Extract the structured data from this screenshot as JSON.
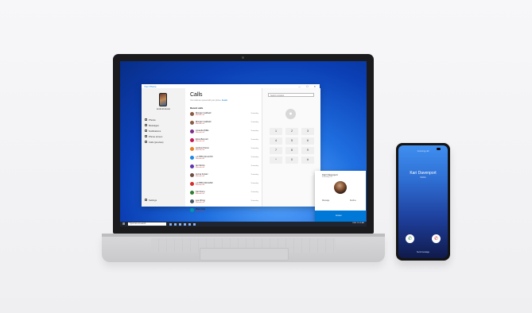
{
  "app": {
    "title": "Your Phone",
    "window_controls": "— ☐ ✕",
    "device_name": "Android device",
    "nav": [
      "Photos",
      "Messages",
      "Notifications",
      "Phone screen",
      "Calls (preview)"
    ],
    "settings": "Settings",
    "calls": {
      "heading": "Calls",
      "subtitle": "Your calls are synced with your phone.",
      "subtitle_link": "Details",
      "recent_label": "Recent calls",
      "rows": [
        {
          "name": "Morgan Caldwell",
          "type": "Missed call",
          "time": "Yesterday",
          "color": "#8a5a44"
        },
        {
          "name": "Morgan Caldwell",
          "type": "Missed call",
          "time": "Yesterday",
          "color": "#8a5a44"
        },
        {
          "name": "Amanda Willis",
          "type": "Missed call",
          "time": "Yesterday",
          "color": "#7b2d8b"
        },
        {
          "name": "Erica Bennett",
          "type": "Missed call",
          "time": "Yesterday",
          "color": "#c2185b"
        },
        {
          "name": "Andrew Pierce",
          "type": "Missed call",
          "time": "Yesterday",
          "color": "#e67e22"
        },
        {
          "name": "+1 (555) 013-4470",
          "type": "Missed call",
          "time": "Yesterday",
          "color": "#1e88e5"
        },
        {
          "name": "Ian Morris",
          "type": "Missed call",
          "time": "Yesterday",
          "color": "#5e35b1"
        },
        {
          "name": "Jenna Fowler",
          "type": "Missed call",
          "time": "Yesterday",
          "color": "#6d4c41"
        },
        {
          "name": "+1 (555) 018-2290",
          "type": "Missed call",
          "time": "Yesterday",
          "color": "#d32f2f"
        },
        {
          "name": "Kari Dunn",
          "type": "Missed call",
          "time": "Yesterday",
          "color": "#2e7d32"
        },
        {
          "name": "Lee Wong",
          "type": "Missed call",
          "time": "Yesterday",
          "color": "#455a64"
        },
        {
          "name": "Miles Cole",
          "type": "Missed call",
          "time": "Yesterday",
          "color": "#0097a7"
        }
      ]
    },
    "dialer": {
      "search_placeholder": "Search contacts",
      "keys": [
        "1",
        "2",
        "3",
        "4",
        "5",
        "6",
        "7",
        "8",
        "9",
        "*",
        "0",
        "#"
      ]
    }
  },
  "toast": {
    "name": "Karri Davenport",
    "number": "Incoming call",
    "message": "Message",
    "decline": "Decline",
    "answer": "Answer"
  },
  "taskbar": {
    "search_placeholder": "Type here to search",
    "tray": "ENG  10:10 AM"
  },
  "phone": {
    "label": "Incoming call",
    "caller_name": "Kari Davenport",
    "caller_number": "Mobile",
    "send_message": "Send message"
  }
}
